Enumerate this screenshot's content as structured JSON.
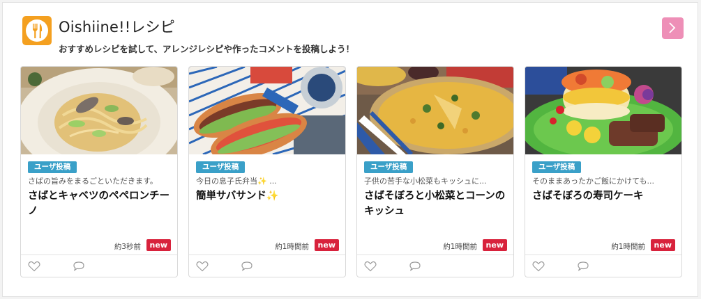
{
  "header": {
    "logo_icon": "fork-knife-icon",
    "title": "Oishiine!!レシピ",
    "subtitle": "おすすめレシピを試して、アレンジレシピや作ったコメントを投稿しよう！",
    "next_icon": "chevron-right-icon"
  },
  "colors": {
    "logo_bg": "#f4a020",
    "next_button": "#ee8fb7",
    "badge": "#3aa0c8",
    "new_badge": "#d8223c"
  },
  "cards": [
    {
      "badge": "ユーザ投稿",
      "desc": "さばの旨みをまるごといただきます。",
      "title": "さばとキャベツのペペロンチーノ",
      "time": "約3秒前",
      "new": "new",
      "photo": "pasta-photo"
    },
    {
      "badge": "ユーザ投稿",
      "desc": "今日の息子氏弁当✨ ...",
      "title": "簡単サバサンド✨",
      "time": "約1時間前",
      "new": "new",
      "photo": "sandwich-photo"
    },
    {
      "badge": "ユーザ投稿",
      "desc": "子供の苦手な小松菜もキッシュに...",
      "title": "さばそぼろと小松菜とコーンのキッシュ",
      "time": "約1時間前",
      "new": "new",
      "photo": "quiche-photo"
    },
    {
      "badge": "ユーザ投稿",
      "desc": "そのままあったかご飯にかけても...",
      "title": "さばそぼろの寿司ケーキ",
      "time": "約1時間前",
      "new": "new",
      "photo": "sushi-cake-photo"
    }
  ],
  "card_actions": {
    "like_icon": "heart-icon",
    "comment_icon": "comment-icon"
  }
}
